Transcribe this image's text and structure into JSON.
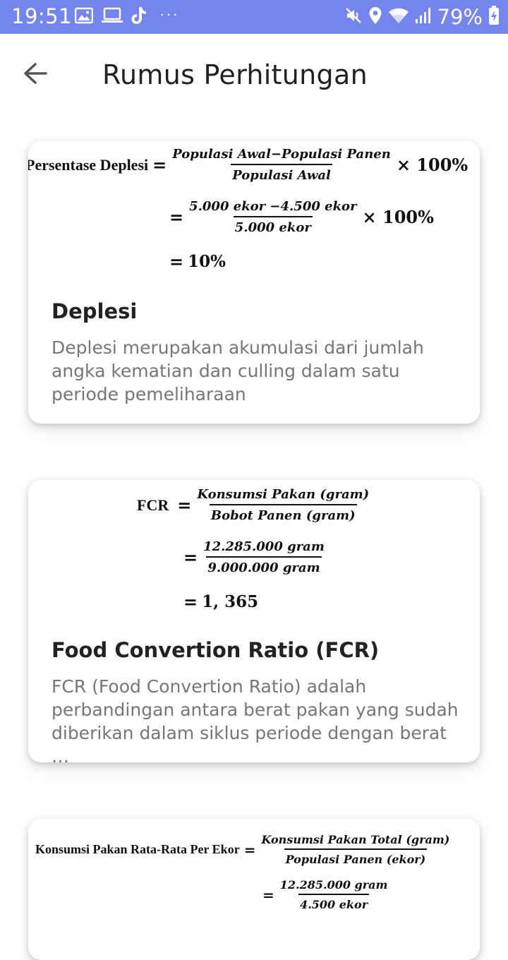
{
  "status_bar": {
    "time": "19:51",
    "battery": "79%",
    "more": "···",
    "icons_left": [
      "gallery-icon",
      "laptop-icon",
      "tiktok-icon"
    ],
    "icons_right": [
      "mute-icon",
      "location-icon",
      "wifi-icon",
      "signal-icon",
      "battery-charging-icon"
    ],
    "background": "#7585ee"
  },
  "app_bar": {
    "title": "Rumus Perhitungan",
    "back_icon": "back-arrow-icon"
  },
  "cards": [
    {
      "formula": {
        "label": "Persentase Deplesi",
        "row1_num": "Populasi Awal−Populasi Panen",
        "row1_den": "Populasi Awal",
        "times": "× 100%",
        "row2_num": "5.000 ekor −4.500 ekor",
        "row2_den": "5.000 ekor",
        "row3_result": "10%"
      },
      "title": "Deplesi",
      "description": "Deplesi merupakan akumulasi dari jumlah angka kematian dan culling dalam satu periode pemeliharaan"
    },
    {
      "formula": {
        "label": "FCR",
        "row1_num": "Konsumsi Pakan (gram)",
        "row1_den": "Bobot Panen (gram)",
        "row2_num": "12.285.000 gram",
        "row2_den": "9.000.000 gram",
        "row3_result": "1, 365"
      },
      "title": "Food Convertion Ratio (FCR)",
      "description": "FCR (Food Convertion Ratio) adalah perbandingan antara berat pakan yang sudah diberikan dalam siklus periode dengan berat …"
    },
    {
      "formula": {
        "label": "Konsumsi Pakan Rata-Rata Per Ekor",
        "row1_num": "Konsumsi Pakan Total (gram)",
        "row1_den": "Populasi Panen (ekor)",
        "row2_num": "12.285.000 gram",
        "row2_den": "4.500 ekor"
      }
    }
  ],
  "colors": {
    "title_text": "#222222",
    "description_text": "#767676"
  }
}
